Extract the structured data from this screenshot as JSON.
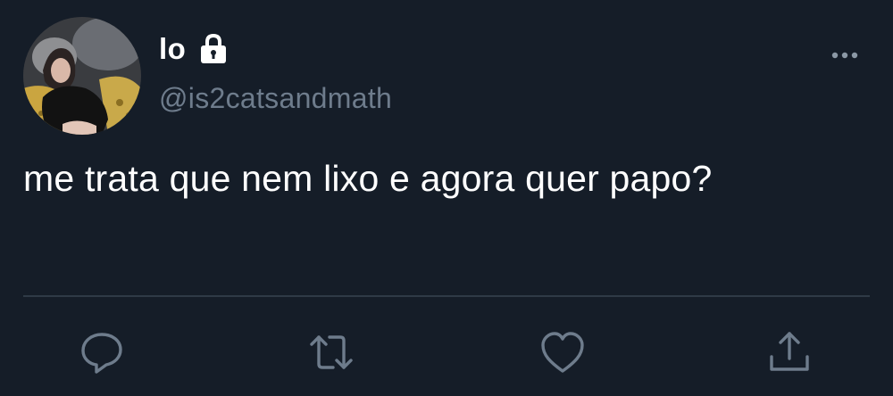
{
  "tweet": {
    "author": {
      "display_name": "lo",
      "handle": "@is2catsandmath",
      "protected": true
    },
    "text": "me trata que nem lixo e agora quer papo?"
  },
  "icons": {
    "lock": "lock-icon",
    "more": "more-icon",
    "reply": "reply-icon",
    "retweet": "retweet-icon",
    "like": "heart-icon",
    "share": "share-icon"
  },
  "colors": {
    "background": "#151d28",
    "primary_text": "#ffffff",
    "secondary_text": "#6e7c8c",
    "icon": "#6e7c8c",
    "divider": "#2f3a46"
  }
}
